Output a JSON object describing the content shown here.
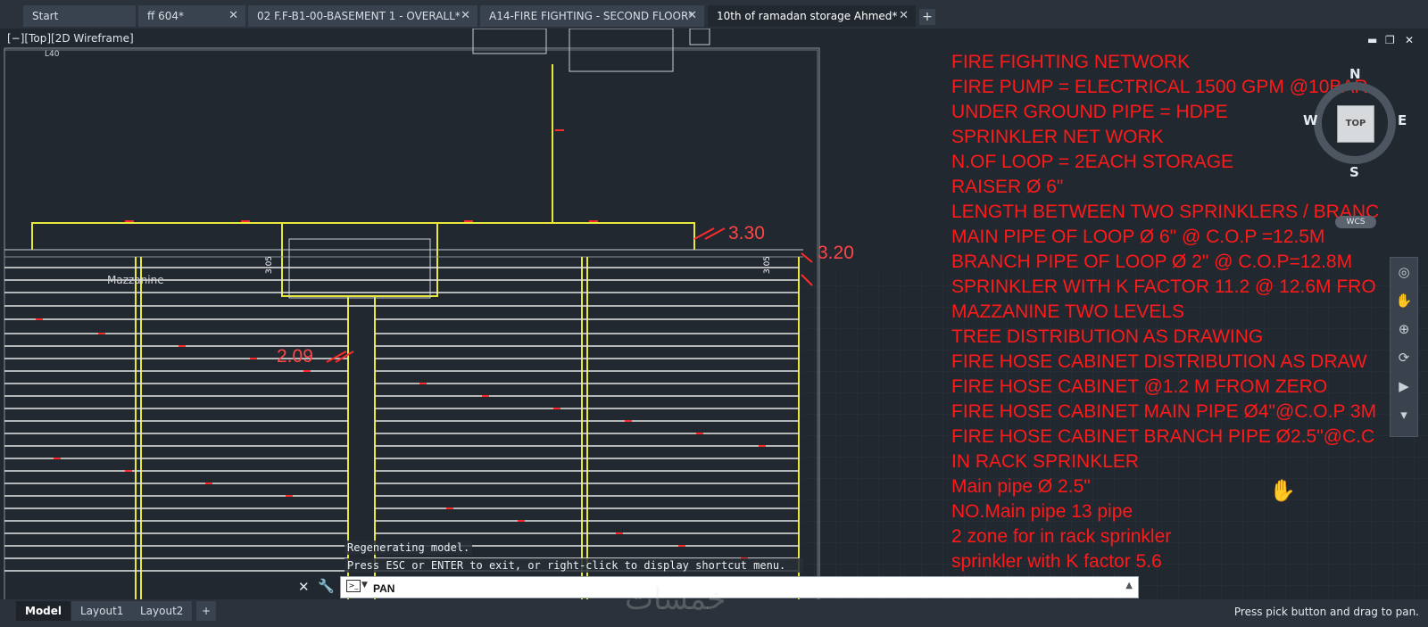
{
  "tabs": [
    {
      "label": "Start",
      "closable": false
    },
    {
      "label": "ff 604*",
      "closable": true
    },
    {
      "label": "02 F.F-B1-00-BASEMENT 1 - OVERALL*",
      "closable": true
    },
    {
      "label": "A14-FIRE FIGHTING - SECOND FLOOR*",
      "closable": true
    },
    {
      "label": "10th of ramadan storage Ahmed*",
      "closable": true,
      "active": true
    }
  ],
  "tab_add": "+",
  "viewport": {
    "label": "[−][Top][2D Wireframe]",
    "window_controls": {
      "minimize": "▬",
      "restore": "❐",
      "close": "✕"
    }
  },
  "drawing": {
    "zone_label": "Mazzanine",
    "dims": [
      "3.30",
      "3.20",
      "2.09"
    ],
    "tag_small": "L40",
    "grid_tags": [
      "3.05",
      "3.05"
    ]
  },
  "notes": [
    "FIRE FIGHTING NETWORK",
    "FIRE PUMP = ELECTRICAL 1500 GPM @10BAR",
    "UNDER GROUND PIPE = HDPE",
    "SPRINKLER NET WORK",
    "N.OF LOOP = 2EACH STORAGE",
    "RAISER Ø 6\"",
    "LENGTH BETWEEN TWO SPRINKLERS / BRANC",
    "MAIN PIPE OF LOOP Ø 6\" @ C.O.P =12.5M",
    "BRANCH PIPE OF LOOP Ø 2\" @ C.O.P=12.8M",
    "SPRINKLER WITH K FACTOR 11.2 @  12.6M FRO",
    "MAZZANINE TWO LEVELS",
    "TREE DISTRIBUTION AS DRAWING",
    "FIRE HOSE CABINET DISTRIBUTION  AS DRAW",
    "FIRE HOSE CABINET @1.2 M FROM ZERO",
    "FIRE HOSE CABINET MAIN PIPE Ø4\"@C.O.P 3M",
    "FIRE HOSE CABINET BRANCH PIPE Ø2.5\"@C.C",
    "IN RACK SPRINKLER",
    "Main pipe Ø 2.5\"",
    "NO.Main pipe 13 pipe",
    "2 zone for in rack sprinkler",
    "sprinkler with K factor 5.6"
  ],
  "viewcube": {
    "n": "N",
    "s": "S",
    "e": "E",
    "w": "W",
    "top": "TOP",
    "wcs": "WCS"
  },
  "command": {
    "log_1": "Regenerating model.",
    "log_2": "Press ESC or ENTER to exit, or right-click to display shortcut menu.",
    "input_value": "PAN"
  },
  "layout_tabs": [
    {
      "label": "Model",
      "active": true
    },
    {
      "label": "Layout1"
    },
    {
      "label": "Layout2"
    }
  ],
  "layout_add": "+",
  "status_message": "Press pick button and drag to pan.",
  "watermark": "خمسات",
  "colors": {
    "accent_red": "#ff1a1a",
    "pipe_yellow": "#e8e83a",
    "bg": "#212830"
  }
}
